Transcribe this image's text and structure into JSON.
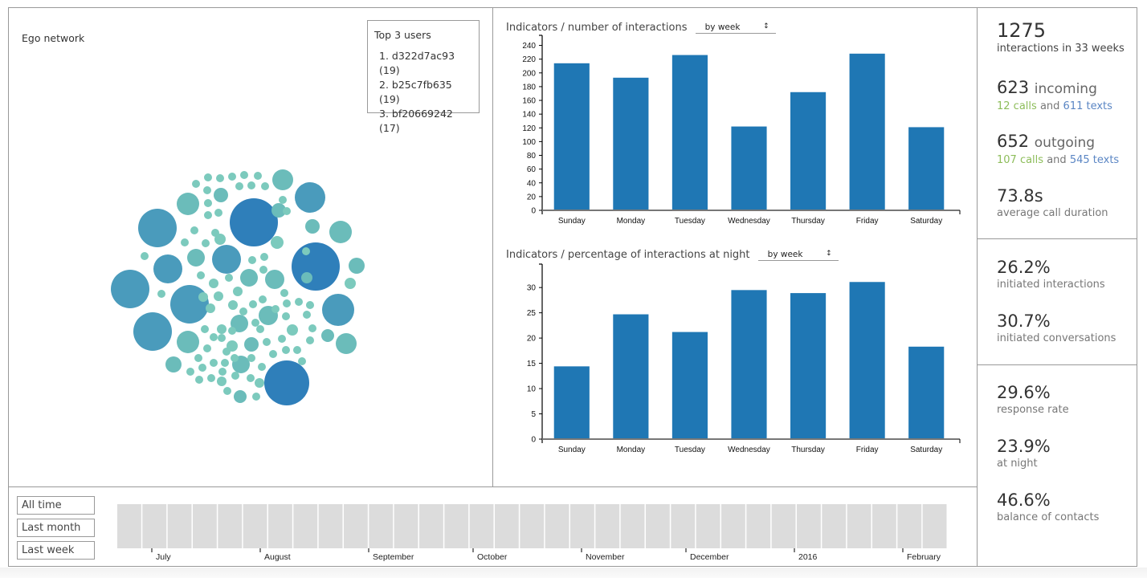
{
  "ego_network": {
    "title": "Ego network",
    "colors": {
      "large": "#2f7fba",
      "medium": "#4a9bbc",
      "small": "#6bbcba",
      "tiny": "#7ccabd"
    }
  },
  "top_users": {
    "title": "Top 3 users",
    "items": [
      {
        "rank": "1.",
        "label": "d322d7ac93 (19)"
      },
      {
        "rank": "2.",
        "label": "b25c7fb635 (19)"
      },
      {
        "rank": "3.",
        "label": "bf20669242 (17)"
      }
    ]
  },
  "charts": {
    "interactions": {
      "title": "Indicators / number of interactions",
      "select_value": "by week"
    },
    "night": {
      "title": "Indicators / percentage of interactions at night",
      "select_value": "by week"
    }
  },
  "chart_data": [
    {
      "type": "bar",
      "title": "Indicators / number of interactions",
      "categories": [
        "Sunday",
        "Monday",
        "Tuesday",
        "Wednesday",
        "Thursday",
        "Friday",
        "Saturday"
      ],
      "values": [
        214,
        193,
        226,
        122,
        172,
        228,
        121
      ],
      "yticks": [
        0,
        20,
        40,
        60,
        80,
        100,
        120,
        140,
        160,
        180,
        200,
        220,
        240
      ],
      "ylim": [
        0,
        250
      ],
      "xlabel": "",
      "ylabel": "",
      "color": "#1f77b4"
    },
    {
      "type": "bar",
      "title": "Indicators / percentage of interactions at night",
      "categories": [
        "Sunday",
        "Monday",
        "Tuesday",
        "Wednesday",
        "Thursday",
        "Friday",
        "Saturday"
      ],
      "values": [
        14.4,
        24.7,
        21.2,
        29.5,
        28.9,
        31.1,
        18.3
      ],
      "yticks": [
        0,
        5,
        10,
        15,
        20,
        25,
        30
      ],
      "ylim": [
        0,
        34
      ],
      "xlabel": "",
      "ylabel": "",
      "color": "#1f77b4"
    }
  ],
  "stats": {
    "total": {
      "value": "1275",
      "label": "interactions in 33 weeks"
    },
    "incoming": {
      "value": "623",
      "word": "incoming",
      "calls": "12 calls",
      "and": "and",
      "texts": "611 texts"
    },
    "outgoing": {
      "value": "652",
      "word": "outgoing",
      "calls": "107 calls",
      "and": "and",
      "texts": "545 texts"
    },
    "duration": {
      "value": "73.8s",
      "label": "average call duration"
    },
    "initiated_interactions": {
      "value": "26.2%",
      "label": "initiated interactions"
    },
    "initiated_conversations": {
      "value": "30.7%",
      "label": "initiated conversations"
    },
    "response_rate": {
      "value": "29.6%",
      "label": "response rate"
    },
    "night": {
      "value": "23.9%",
      "label": "at night"
    },
    "balance": {
      "value": "46.6%",
      "label": "balance of contacts"
    },
    "colors": {
      "calls": "#8dbd5a",
      "texts": "#5b86c4"
    }
  },
  "range_buttons": [
    "All time range",
    "Last month",
    "Last week"
  ],
  "timeline": {
    "weeks": 33,
    "months": [
      "July",
      "August",
      "September",
      "October",
      "November",
      "December",
      "2016",
      "February"
    ],
    "cell_color": "#dcdcdc"
  }
}
